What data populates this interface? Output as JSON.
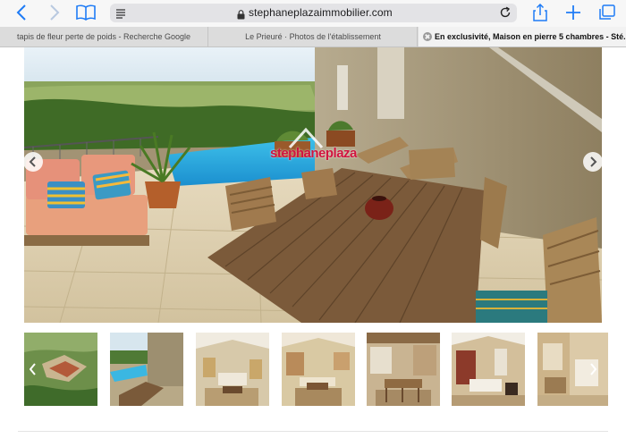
{
  "browser": {
    "url": "stephaneplazaimmobilier.com",
    "icons": [
      "back-icon",
      "forward-icon",
      "bookmarks-icon",
      "reader-icon",
      "lock-icon",
      "reload-icon",
      "share-icon",
      "new-tab-icon",
      "tabs-icon"
    ],
    "tabs": [
      {
        "title": "tapis de fleur perte de poids - Recherche Google",
        "active": false
      },
      {
        "title": "Le Prieuré · Photos de l'établissement",
        "active": false
      },
      {
        "title": "En exclusivité, Maison en pierre 5 chambres - Sté...",
        "active": true
      }
    ]
  },
  "gallery": {
    "watermark_prefix": "stephane",
    "watermark_suffix": "plaza",
    "main_photo": "stone-house-terrace-with-pool-and-table",
    "thumbnails": [
      "aerial-view",
      "pool-terrace",
      "living-room",
      "dining-room",
      "kitchen",
      "bedroom",
      "bathroom"
    ]
  },
  "colors": {
    "accent": "#1a73e8",
    "watermark": "#d1143f",
    "ios_blue": "#1f7cf6"
  }
}
